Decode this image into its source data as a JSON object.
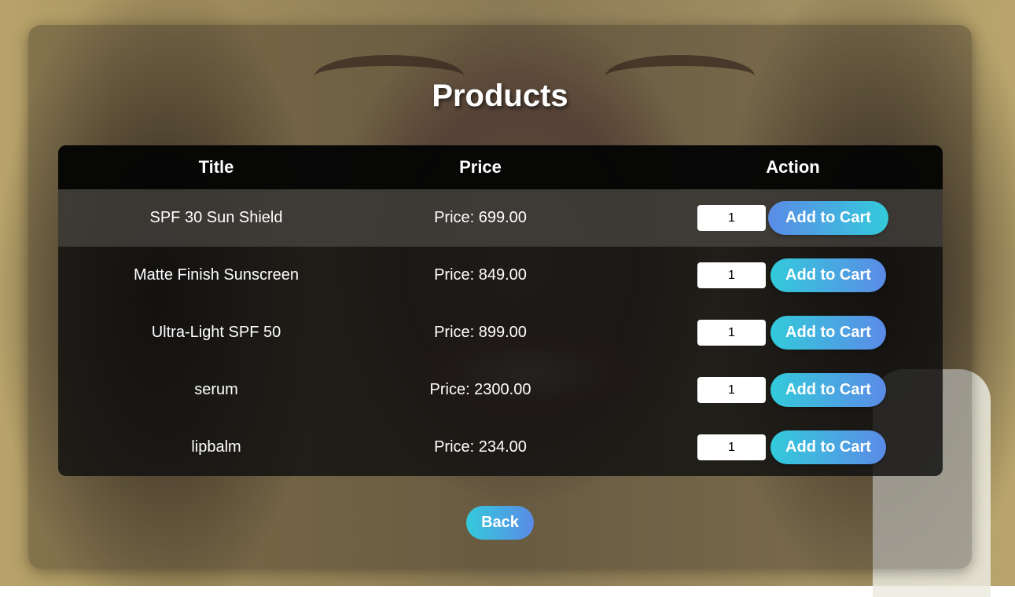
{
  "page": {
    "title": "Products",
    "back_label": "Back"
  },
  "table": {
    "headers": [
      "Title",
      "Price",
      "Action"
    ],
    "rows": [
      {
        "title": "SPF 30 Sun Shield",
        "price": "Price: 699.00",
        "qty": "1",
        "button": "Add to Cart"
      },
      {
        "title": "Matte Finish Sunscreen",
        "price": "Price: 849.00",
        "qty": "1",
        "button": "Add to Cart"
      },
      {
        "title": "Ultra-Light SPF 50",
        "price": "Price: 899.00",
        "qty": "1",
        "button": "Add to Cart"
      },
      {
        "title": "serum",
        "price": "Price: 2300.00",
        "qty": "1",
        "button": "Add to Cart"
      },
      {
        "title": "lipbalm",
        "price": "Price: 234.00",
        "qty": "1",
        "button": "Add to Cart"
      }
    ]
  },
  "colors": {
    "button_gradient_start": "#33cadb",
    "button_gradient_end": "#5b8be6"
  }
}
